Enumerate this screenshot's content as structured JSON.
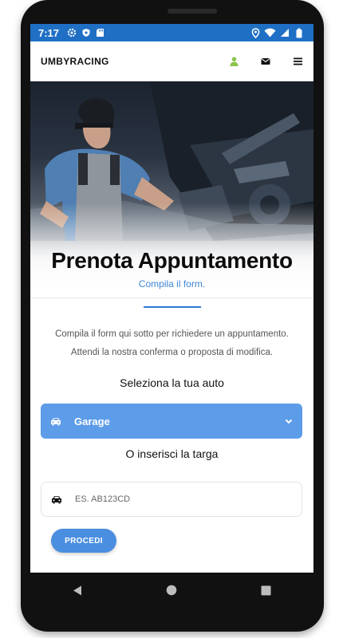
{
  "status_bar": {
    "time": "7:17",
    "left_icons": [
      "gear-icon",
      "shield-icon",
      "sd-card-icon"
    ],
    "right_icons": [
      "location-icon",
      "wifi-icon",
      "signal-icon",
      "battery-icon"
    ],
    "color": "#1f6fc5"
  },
  "header": {
    "brand": "UMBYRACING",
    "icons": [
      "user-icon",
      "envelope-icon",
      "menu-icon"
    ],
    "user_icon_color": "#8bc34a"
  },
  "hero": {
    "title": "Prenota Appuntamento",
    "subtitle": "Compila il form."
  },
  "intro": {
    "line1": "Compila il form qui sotto per richiedere un appuntamento.",
    "line2": "Attendi la nostra conferma o proposta di modifica."
  },
  "car_select": {
    "label": "Seleziona la tua auto",
    "selected": "Garage",
    "color": "#5d9ce8"
  },
  "plate": {
    "label": "O inserisci la targa",
    "placeholder": "ES. AB123CD"
  },
  "submit": {
    "label": "PROCEDI",
    "color": "#4a8ee0"
  },
  "nav": {
    "icons": [
      "back-icon",
      "home-icon",
      "recents-icon"
    ]
  }
}
